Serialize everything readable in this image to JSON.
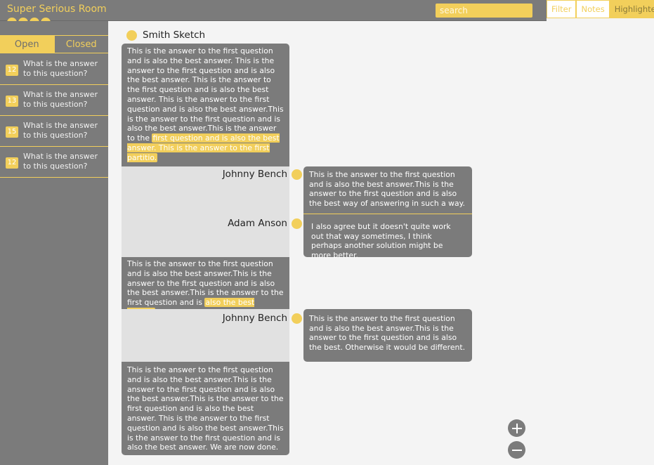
{
  "app": {
    "title": "Super Serious Room",
    "dot_count": 4
  },
  "search": {
    "placeholder": "search",
    "value": ""
  },
  "view_tabs": [
    {
      "label": "Filter",
      "active": false
    },
    {
      "label": "Notes",
      "active": false
    },
    {
      "label": "Highlighted",
      "active": true
    }
  ],
  "sidebar": {
    "segments": {
      "open": "Open",
      "closed": "Closed",
      "selected": "Open"
    },
    "questions": [
      {
        "count": "12",
        "text": "What is the answer to this question?"
      },
      {
        "count": "13",
        "text": "What is the answer to this question?"
      },
      {
        "count": "15",
        "text": "What is the answer to this question?"
      },
      {
        "count": "12",
        "text": "What is the answer to this question?"
      }
    ]
  },
  "document": {
    "author": "Smith Sketch",
    "blocks": [
      {
        "text": "This is the answer to the first question and is also the best answer. This is the answer to the first question and is also the best answer. This is the answer to the first question and is also the best answer. This is the answer to the first question and is also the best answer.This is the answer to the first question and is also the best answer.This is the answer to the ",
        "highlight": "first question and is also the best answer. This is the answer to the first partitio."
      },
      {
        "text": "This is the answer to the first question and is also the best answer.This is the answer to the first question and is also the best answer.This is the answer to the first question and is ",
        "highlight": "also the best answer"
      },
      {
        "text": "This is the answer to the first question and is also the best answer.This is the answer to the first question and is also the best answer.This is the answer to the first question and is also the best answer. This is the answer to the first question and is also the best answer.This is the answer to the first question and is also the best answer. We are now done.",
        "highlight": ""
      }
    ]
  },
  "comments": [
    {
      "author": "Johnny Bench",
      "text": "This is the answer to the first question and is also the best answer.This is the answer to the first question and is also the best way of answering in such a way."
    },
    {
      "author": "Adam Anson",
      "text": "I also agree but it doesn't quite work out that way sometimes, I think perhaps another solution might be more better."
    },
    {
      "author": "Johnny Bench",
      "text": "This is the answer to the first question and is also the best answer.This is the answer to the first question and is also the best. Otherwise it would be different."
    }
  ],
  "colors": {
    "accent": "#f2cf5b",
    "panel": "#7b7b7b",
    "background": "#f4f4f4",
    "gap": "#e1e1e1"
  },
  "icons": {
    "zoom_in": "plus-circle-icon",
    "zoom_out": "minus-circle-icon"
  }
}
